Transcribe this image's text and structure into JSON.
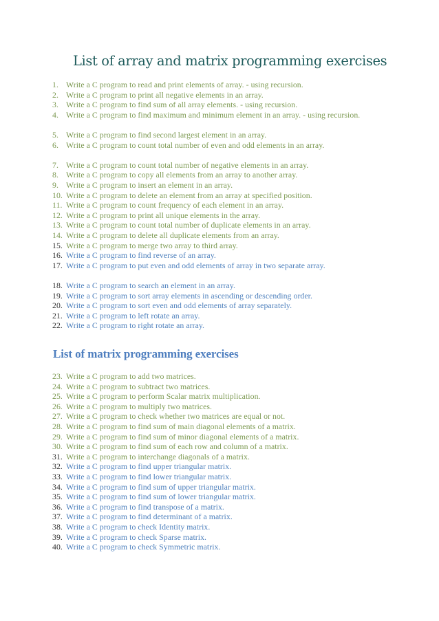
{
  "title": "List of array and matrix programming exercises",
  "matrix_heading": "List of matrix programming exercises",
  "colors": {
    "title": "#1f5c5c",
    "heading": "#4f7fbf",
    "green_text": "#7d9a53",
    "blue_text": "#4f81bd",
    "dark_number": "#333333"
  },
  "array_items": [
    {
      "num": "1.",
      "text": "Write a C program to read and print elements of array. - using recursion."
    },
    {
      "num": "2.",
      "text": "Write a C program to print all negative elements in an array."
    },
    {
      "num": "3.",
      "text": "Write a C program to find sum of all array elements. - using recursion."
    },
    {
      "num": "4.",
      "text": "Write a C program to find maximum and minimum element in an array. - using recursion."
    },
    {
      "num": "5.",
      "text": "Write a C program to find second largest element in an array."
    },
    {
      "num": "6.",
      "text": "Write a C program to count total number of even and odd elements in an array."
    },
    {
      "num": "7.",
      "text": "Write a C program to count total number of negative elements in an array."
    },
    {
      "num": "8.",
      "text": "Write a C program to copy all elements from an array to another array."
    },
    {
      "num": "9.",
      "text": "Write a C program to insert an element in an array."
    },
    {
      "num": "10.",
      "text": "Write a C program to delete an element from an array at specified position."
    },
    {
      "num": "11.",
      "text": "Write a C program to count frequency of each element in an array."
    },
    {
      "num": "12.",
      "text": "Write a C program to print all unique elements in the array."
    },
    {
      "num": "13.",
      "text": "Write a C program to count total number of duplicate elements in an array."
    },
    {
      "num": "14.",
      "text": "Write a C program to delete all duplicate elements from an array."
    },
    {
      "num": "15.",
      "text": "Write a C program to merge two array to third array."
    },
    {
      "num": "16.",
      "text": "Write a C program to find reverse of an array."
    },
    {
      "num": "17.",
      "text": "Write a C program to put even and odd elements of array in two separate array."
    },
    {
      "num": "18.",
      "text": "Write a C program to search an element in an array."
    },
    {
      "num": "19.",
      "text": "Write a C program to sort array elements in ascending or descending order."
    },
    {
      "num": "20.",
      "text": "Write a C program to sort even and odd elements of array separately."
    },
    {
      "num": "21.",
      "text": "Write a C program to left rotate an array."
    },
    {
      "num": "22.",
      "text": "Write a C program to right rotate an array."
    }
  ],
  "matrix_items": [
    {
      "num": "23.",
      "text": "Write a C program to add two matrices."
    },
    {
      "num": "24.",
      "text": "Write a C program to subtract two matrices."
    },
    {
      "num": "25.",
      "text": "Write a C program to perform Scalar matrix multiplication."
    },
    {
      "num": "26.",
      "text": "Write a C program to multiply two matrices."
    },
    {
      "num": "27.",
      "text": "Write a C program to check whether two matrices are equal or not."
    },
    {
      "num": "28.",
      "text": "Write a C program to find sum of main diagonal elements of a matrix."
    },
    {
      "num": "29.",
      "text": "Write a C program to find sum of minor diagonal elements of a matrix."
    },
    {
      "num": "30.",
      "text": "Write a C program to find sum of each row and column of a matrix."
    },
    {
      "num": "31.",
      "text": "Write a C program to interchange diagonals of a matrix."
    },
    {
      "num": "32.",
      "text": "Write a C program to find upper triangular matrix."
    },
    {
      "num": "33.",
      "text": "Write a C program to find lower triangular matrix."
    },
    {
      "num": "34.",
      "text": "Write a C program to find sum of upper triangular matrix."
    },
    {
      "num": "35.",
      "text": "Write a C program to find sum of lower triangular matrix."
    },
    {
      "num": "36.",
      "text": "Write a C program to find transpose of a matrix."
    },
    {
      "num": "37.",
      "text": "Write a C program to find determinant of a matrix."
    },
    {
      "num": "38.",
      "text": "Write a C program to check Identity matrix."
    },
    {
      "num": "39.",
      "text": "Write a C program to check Sparse matrix."
    },
    {
      "num": "40.",
      "text": "Write a C program to check Symmetric matrix."
    }
  ]
}
